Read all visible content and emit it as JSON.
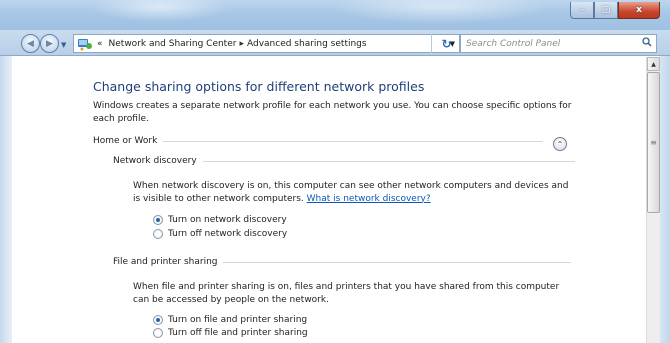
{
  "window": {
    "minimize": "–",
    "maximize": "□",
    "close": "x"
  },
  "nav": {
    "back": "◀",
    "forward": "▶",
    "breadcrumb_prefix": "«",
    "breadcrumb_items": [
      "Network and Sharing Center",
      "Advanced sharing settings"
    ],
    "separator": "▸",
    "dropdown": "▼",
    "refresh": "↻",
    "search_placeholder": "Search Control Panel",
    "search_icon": "search-icon"
  },
  "content": {
    "title": "Change sharing options for different network profiles",
    "description": "Windows creates a separate network profile for each network you use. You can choose specific options for each profile.",
    "profile": "Home or Work",
    "collapse": "⌃",
    "sections": [
      {
        "heading": "Network discovery",
        "text": "When network discovery is on, this computer can see other network computers and devices and is visible to other network computers.",
        "link": "What is network discovery?",
        "options": [
          {
            "label": "Turn on network discovery",
            "selected": true
          },
          {
            "label": "Turn off network discovery",
            "selected": false
          }
        ]
      },
      {
        "heading": "File and printer sharing",
        "text": "When file and printer sharing is on, files and printers that you have shared from this computer can be accessed by people on the network.",
        "options": [
          {
            "label": "Turn on file and printer sharing",
            "selected": true
          },
          {
            "label": "Turn off file and printer sharing",
            "selected": false
          }
        ]
      }
    ]
  },
  "scrollbar": {
    "up": "▲",
    "grip": "≡"
  },
  "colors": {
    "title_text": "#1e3f7a",
    "link": "#0b58b6",
    "close_button": "#c8452a"
  }
}
